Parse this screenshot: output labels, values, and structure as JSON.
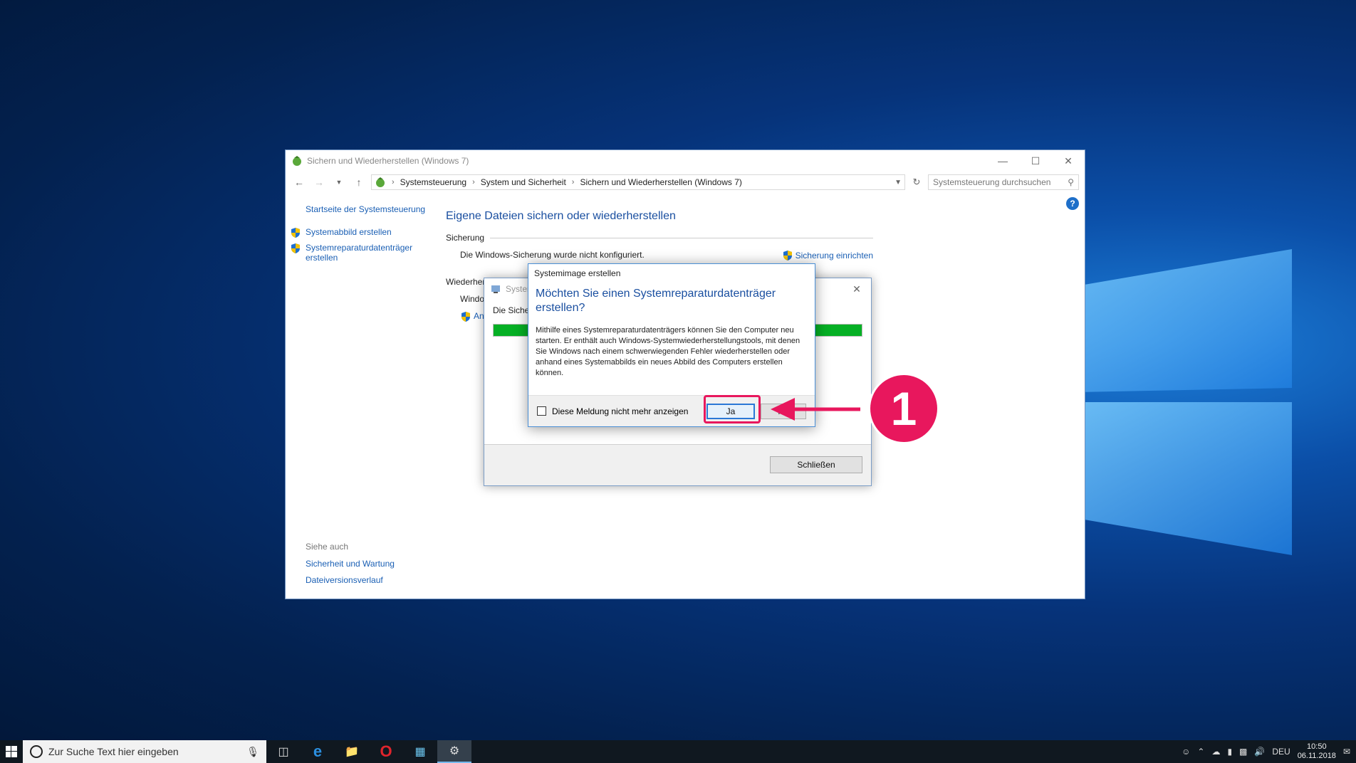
{
  "window": {
    "title": "Sichern und Wiederherstellen (Windows 7)",
    "breadcrumb": [
      "Systemsteuerung",
      "System und Sicherheit",
      "Sichern und Wiederherstellen (Windows 7)"
    ],
    "search_placeholder": "Systemsteuerung durchsuchen"
  },
  "sidebar": {
    "home": "Startseite der Systemsteuerung",
    "items": [
      "Systemabbild erstellen",
      "Systemreparaturdatenträger erstellen"
    ],
    "see_also_header": "Siehe auch",
    "see_also": [
      "Sicherheit und Wartung",
      "Dateiversionsverlauf"
    ]
  },
  "content": {
    "heading": "Eigene Dateien sichern oder wiederherstellen",
    "backup_header": "Sicherung",
    "backup_status": "Die Windows-Sicherung wurde nicht konfiguriert.",
    "backup_action": "Sicherung einrichten",
    "restore_header": "Wiederher",
    "restore_text": "Windo",
    "restore_action": "And"
  },
  "progress_dialog": {
    "title": "Syster",
    "text": "Die Sicher",
    "progress": 1.0,
    "close_label": "Schließen"
  },
  "message_box": {
    "title": "Systemimage erstellen",
    "heading": "Möchten Sie einen Systemreparaturdatenträger erstellen?",
    "body": "Mithilfe eines Systemreparaturdatenträgers können Sie den Computer neu starten. Er enthält auch Windows-Systemwiederherstellungstools, mit denen Sie Windows nach einem schwerwiegenden Fehler wiederherstellen oder anhand eines Systemabbilds ein neues Abbild des Computers erstellen können.",
    "checkbox_label": "Diese Meldung nicht mehr anzeigen",
    "yes_label": "Ja",
    "no_label": "Ne"
  },
  "annotation": {
    "number": "1",
    "color": "#e8175d"
  },
  "taskbar": {
    "search_placeholder": "Zur Suche Text hier eingeben",
    "language": "DEU",
    "time": "10:50",
    "date": "06.11.2018"
  }
}
